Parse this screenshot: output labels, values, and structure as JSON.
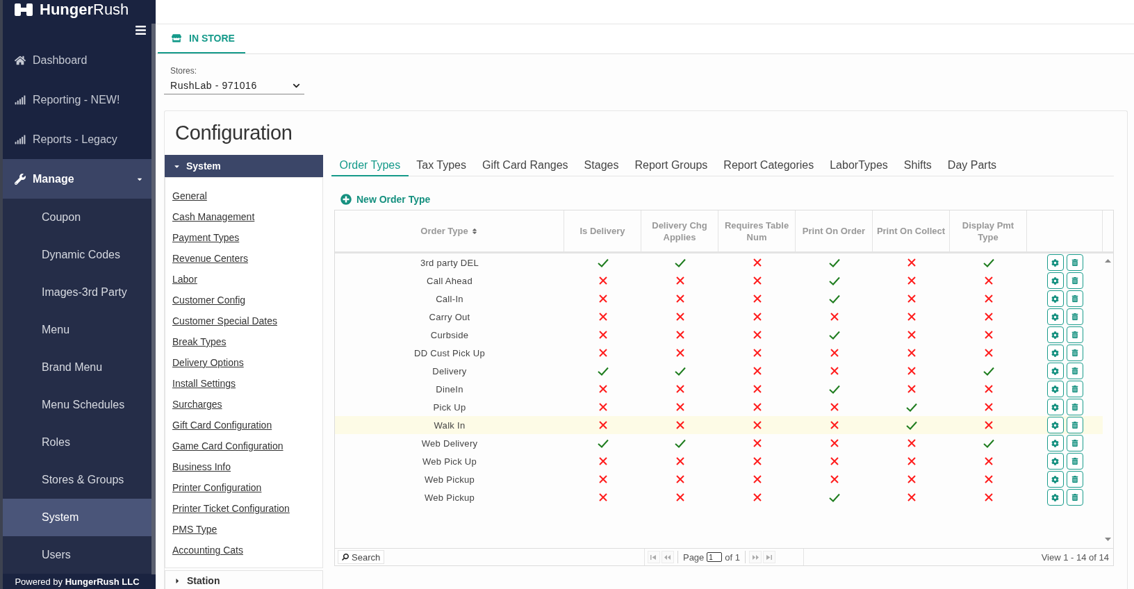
{
  "sidebar": {
    "logo": "**Hunger**Rush",
    "items": [
      {
        "label": "Dashboard",
        "selected": false
      },
      {
        "label": "Reporting - NEW!",
        "selected": false
      },
      {
        "label": "Reports - Legacy",
        "selected": false
      },
      {
        "label": "Manage",
        "selected": false,
        "expanded": true,
        "children": [
          {
            "label": "Coupon",
            "selected": false
          },
          {
            "label": "Dynamic Codes",
            "selected": false
          },
          {
            "label": "Images-3rd Party",
            "selected": false
          },
          {
            "label": "Menu",
            "selected": false
          },
          {
            "label": "Brand Menu",
            "selected": false
          },
          {
            "label": "Menu Schedules",
            "selected": false
          },
          {
            "label": "Roles",
            "selected": false
          },
          {
            "label": "Stores & Groups",
            "selected": false
          },
          {
            "label": "System",
            "selected": true
          },
          {
            "label": "Users",
            "selected": false
          }
        ]
      }
    ],
    "footer": "Powered by **HungerRush LLC**"
  },
  "store_tab": {
    "label": "IN STORE",
    "selected": true
  },
  "store_selector": {
    "label": "Stores:",
    "value": "RushLab - 971016"
  },
  "configuration": {
    "title": "Configuration",
    "sections": [
      {
        "title": "System",
        "expanded": true,
        "links": [
          "General",
          "Cash Management",
          "Payment Types",
          "Revenue Centers",
          "Labor",
          "Customer Config",
          "Customer Special Dates",
          "Break Types",
          "Delivery Options",
          "Install Settings",
          "Surcharges",
          "Gift Card Configuration",
          "Game Card Configuration",
          "Business Info",
          "Printer Configuration",
          "Printer Ticket Configuration",
          "PMS Type",
          "Accounting Cats"
        ]
      },
      {
        "title": "Station",
        "expanded": false
      }
    ],
    "tabs": [
      {
        "label": "Order Types",
        "selected": true
      },
      {
        "label": "Tax Types",
        "selected": false
      },
      {
        "label": "Gift Card Ranges",
        "selected": false
      },
      {
        "label": "Stages",
        "selected": false
      },
      {
        "label": "Report Groups",
        "selected": false
      },
      {
        "label": "Report Categories",
        "selected": false
      },
      {
        "label": "LaborTypes",
        "selected": false
      },
      {
        "label": "Shifts",
        "selected": false
      },
      {
        "label": "Day Parts",
        "selected": false
      }
    ],
    "new_button": "New Order Type",
    "table": {
      "columns": [
        {
          "label": "Order Type",
          "sortable": true
        },
        {
          "label": "Is Delivery",
          "sortable": false
        },
        {
          "label": "Delivery Chg Applies",
          "sortable": false
        },
        {
          "label": "Requires Table Num",
          "sortable": false
        },
        {
          "label": "Print On Order",
          "sortable": false
        },
        {
          "label": "Print On Collect",
          "sortable": false
        },
        {
          "label": "Display Pmt Type",
          "sortable": false
        }
      ],
      "rows": [
        {
          "order_type": "3rd party DEL",
          "flags": [
            true,
            true,
            false,
            true,
            false,
            true
          ],
          "selected": false
        },
        {
          "order_type": "Call Ahead",
          "flags": [
            false,
            false,
            false,
            true,
            false,
            false
          ],
          "selected": false
        },
        {
          "order_type": "Call-In",
          "flags": [
            false,
            false,
            false,
            true,
            false,
            false
          ],
          "selected": false
        },
        {
          "order_type": "Carry Out",
          "flags": [
            false,
            false,
            false,
            false,
            false,
            false
          ],
          "selected": false
        },
        {
          "order_type": "Curbside",
          "flags": [
            false,
            false,
            false,
            true,
            false,
            false
          ],
          "selected": false
        },
        {
          "order_type": "DD Cust Pick Up",
          "flags": [
            false,
            false,
            false,
            false,
            false,
            false
          ],
          "selected": false
        },
        {
          "order_type": "Delivery",
          "flags": [
            true,
            true,
            false,
            false,
            false,
            true
          ],
          "selected": false
        },
        {
          "order_type": "DineIn",
          "flags": [
            false,
            false,
            false,
            true,
            false,
            false
          ],
          "selected": false
        },
        {
          "order_type": "Pick Up",
          "flags": [
            false,
            false,
            false,
            false,
            true,
            false
          ],
          "selected": false
        },
        {
          "order_type": "Walk In",
          "flags": [
            false,
            false,
            false,
            false,
            true,
            false
          ],
          "selected": true
        },
        {
          "order_type": "Web Delivery",
          "flags": [
            true,
            true,
            false,
            false,
            false,
            true
          ],
          "selected": false
        },
        {
          "order_type": "Web Pick Up",
          "flags": [
            false,
            false,
            false,
            false,
            false,
            false
          ],
          "selected": false
        },
        {
          "order_type": "Web Pickup",
          "flags": [
            false,
            false,
            false,
            false,
            false,
            false
          ],
          "selected": false
        },
        {
          "order_type": "Web Pickup",
          "flags": [
            false,
            false,
            false,
            true,
            false,
            false
          ],
          "selected": false
        }
      ]
    },
    "pager": {
      "search": "Search",
      "page_label": "Page",
      "page": "1",
      "page_total": "of 1",
      "records": "View 1 - 14 of 14"
    }
  }
}
